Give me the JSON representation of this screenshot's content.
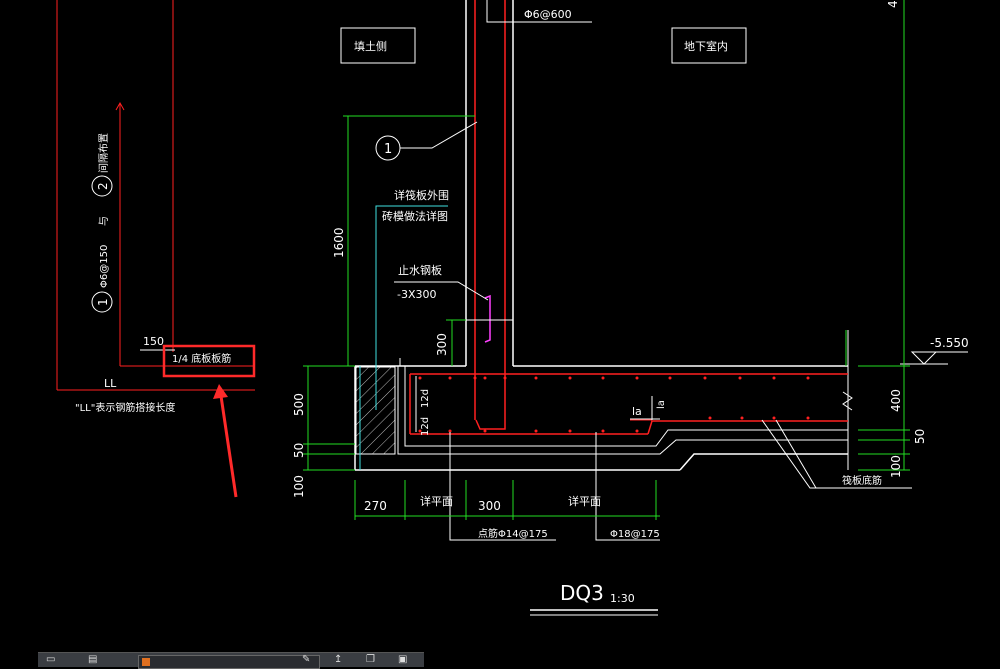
{
  "drawing": {
    "title": "DQ3",
    "scale": "1:30",
    "labels": {
      "fill_side": "填土侧",
      "basement_inside": "地下室内",
      "rebar_top": "Φ6@600",
      "note_see_raft_1": "详筏板外围",
      "note_see_raft_2": "砖模做法详图",
      "waterstop_1": "止水钢板",
      "waterstop_2": "-3X300",
      "bottom_rebar_label": "1/4  底板板筋",
      "ll_note": "\"LL\"表示钢筋搭接长度",
      "ll": "LL",
      "vert_note_1": "Φ6@150",
      "vert_note_2": "与",
      "vert_note_3": "间隔布置",
      "raft_bottom_rebar": "筏板底筋",
      "point_rebar": "点筋Φ14@175",
      "rebar_18": "Φ18@175",
      "elevation": "-5.550",
      "la_1": "la",
      "la_2": "la",
      "d12_1": "12d",
      "d12_2": "12d",
      "see_plan_1": "详平面",
      "see_plan_2": "详平面",
      "callout_1": "1",
      "callout_2": "2",
      "callout_3": "1"
    },
    "dimensions": {
      "d1600": "1600",
      "d300v": "300",
      "d150": "150",
      "d500": "500",
      "d50l": "50",
      "d100l": "100",
      "d270": "270",
      "d300h": "300",
      "d400": "400",
      "d50r": "50",
      "d100r": "100",
      "d4": "4"
    }
  },
  "colors": {
    "background": "#000000",
    "wall": "#ffffff",
    "rebar": "#ff2020",
    "dimension": "#22dd22",
    "leader": "#40e0e0",
    "highlight": "#ff2a2a",
    "magenta": "#ff40ff"
  },
  "taskbar": {
    "icons": [
      "window-icon",
      "file-icon",
      "pen-icon",
      "arrow-icon",
      "copy-icon",
      "save-icon"
    ]
  }
}
